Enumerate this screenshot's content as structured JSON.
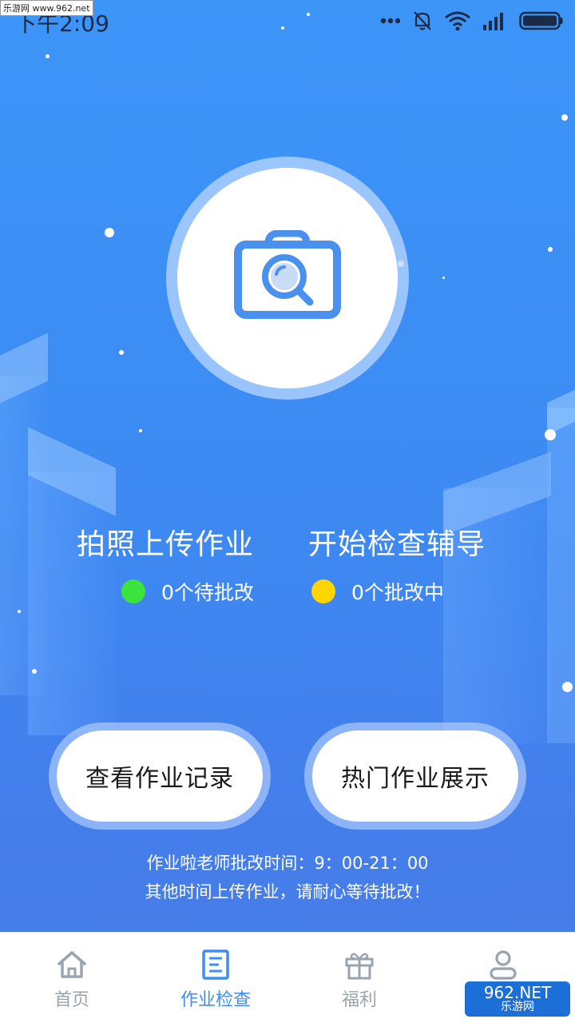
{
  "status_bar": {
    "time": "下午2:09",
    "watermark": "乐游网 www.962.net",
    "icons": [
      "more-dots-icon",
      "bell-muted-icon",
      "wifi-icon",
      "signal-icon",
      "battery-icon"
    ]
  },
  "main": {
    "camera_icon": "camera-search-icon",
    "title_left": "拍照上传作业",
    "title_right": "开始检查辅导",
    "pending_text": "0个待批改",
    "pending_color": "#3de33d",
    "grading_text": "0个批改中",
    "grading_color": "#ffd500",
    "button_records": "查看作业记录",
    "button_showcase": "热门作业展示",
    "note_line1": "作业啦老师批改时间：9：00-21：00",
    "note_line2": "其他时间上传作业，请耐心等待批改！"
  },
  "tabbar": {
    "tabs": [
      {
        "label": "首页",
        "icon": "home-icon",
        "active": false
      },
      {
        "label": "作业检查",
        "icon": "document-icon",
        "active": true
      },
      {
        "label": "福利",
        "icon": "gift-icon",
        "active": false
      },
      {
        "label": "",
        "icon": "user-icon",
        "active": false
      }
    ]
  },
  "watermark_bottom": {
    "text": "962.NET",
    "sub": "乐游网"
  },
  "colors": {
    "accent": "#3f8df0",
    "background": "#3d8ff5",
    "inactive_tab": "#9aa3b0"
  }
}
